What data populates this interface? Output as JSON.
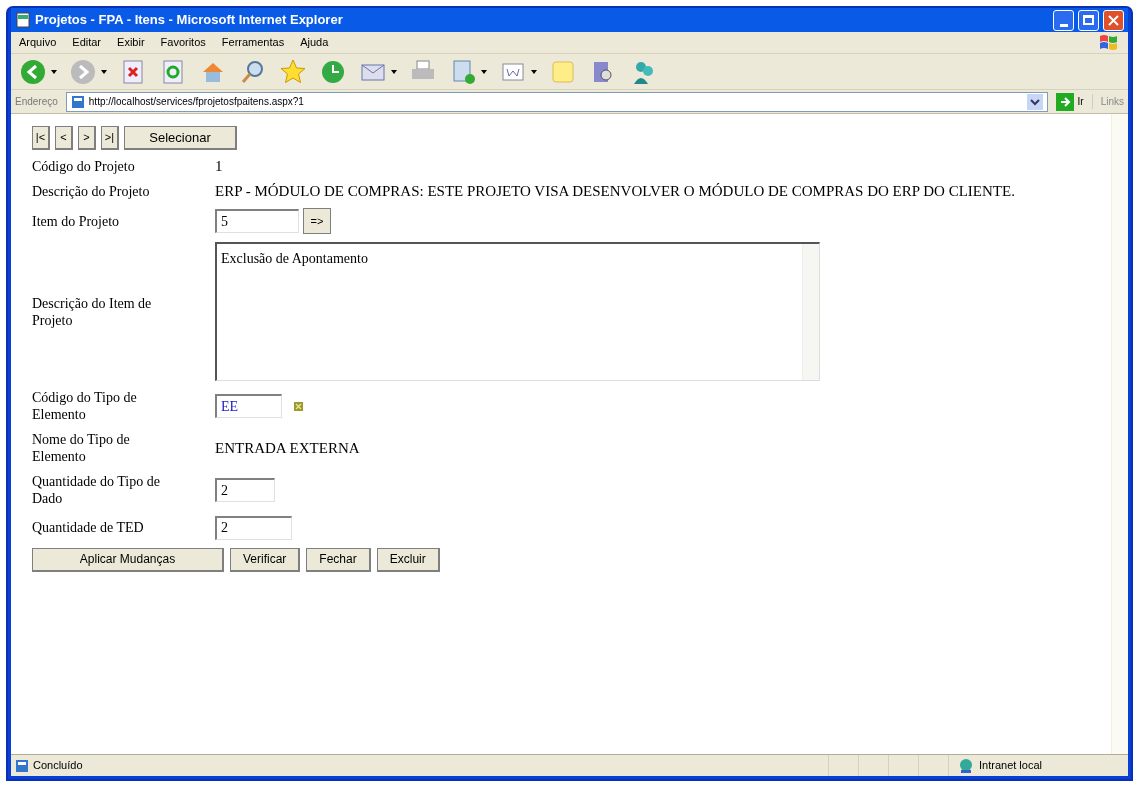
{
  "window": {
    "title": "Projetos - FPA - Itens - Microsoft Internet Explorer"
  },
  "menu": [
    "Arquivo",
    "Editar",
    "Exibir",
    "Favoritos",
    "Ferramentas",
    "Ajuda"
  ],
  "address": {
    "label": "Endereço",
    "url": "http://localhost/services/fprojetosfpaitens.aspx?1",
    "go": "Ir",
    "links": "Links"
  },
  "nav_buttons": [
    "|<",
    "<",
    ">",
    ">|"
  ],
  "select_button": "Selecionar",
  "fields": [
    {
      "label": "Código do Projeto",
      "kind": "text",
      "value": "1"
    },
    {
      "label": "Descrição do Projeto",
      "kind": "text",
      "value": "ERP - MÓDULO DE COMPRAS: ESTE PROJETO VISA DESENVOLVER O MÓDULO DE COMPRAS DO ERP DO CLIENTE."
    },
    {
      "label": "Item do Projeto",
      "kind": "input_button",
      "value": "5",
      "button": "=>"
    },
    {
      "label": "Descrição do Item de Projeto",
      "kind": "textarea",
      "value": "Exclusão de Apontamento"
    },
    {
      "label": "Código do Tipo de Elemento",
      "kind": "input_lookup",
      "value": "EE"
    },
    {
      "label": "Nome do Tipo de Elemento",
      "kind": "text",
      "value": "ENTRADA EXTERNA"
    },
    {
      "label": "Quantidade do Tipo de Dado",
      "kind": "input",
      "value": "2"
    },
    {
      "label": "Quantidade de TED",
      "kind": "input",
      "value": "2"
    }
  ],
  "actions": [
    "Aplicar Mudanças",
    "Verificar",
    "Fechar",
    "Excluir"
  ],
  "status_bar": {
    "text": "Concluído",
    "zone": "Intranet local"
  }
}
